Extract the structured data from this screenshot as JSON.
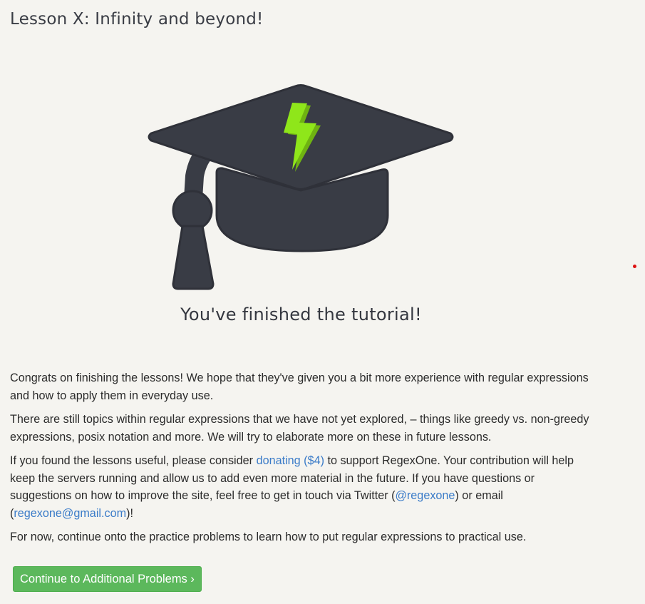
{
  "page": {
    "title": "Lesson X: Infinity and beyond!"
  },
  "hero": {
    "graphic": "graduation-cap-with-lightning-icon",
    "heading": "You've finished the tutorial!",
    "colors": {
      "cap": "#393c45",
      "bolt": "#8fe61a",
      "bolt_shadow": "#6fb312"
    }
  },
  "content": {
    "p1": "Congrats on finishing the lessons! We hope that they've given you a bit more experience with regular expressions and how to apply them in everyday use.",
    "p2": "There are still topics within regular expressions that we have not yet explored, – things like greedy vs. non-greedy expressions, posix notation and more. We will try to elaborate more on these in future lessons.",
    "p3": {
      "before_donate": "If you found the lessons useful, please consider ",
      "donate_link": "donating ($4)",
      "after_donate": " to support RegexOne. Your contribution will help keep the servers running and allow us to add even more material in the future. If you have questions or suggestions on how to improve the site, feel free to get in touch via Twitter (",
      "twitter_link": "@regexone",
      "between": ") or email (",
      "email_link": "regexone@gmail.com",
      "end": ")!"
    },
    "p4": "For now, continue onto the practice problems to learn how to put regular expressions to practical use."
  },
  "actions": {
    "continue_label": "Continue to Additional Problems ›",
    "button_color": "#5cb85c"
  }
}
